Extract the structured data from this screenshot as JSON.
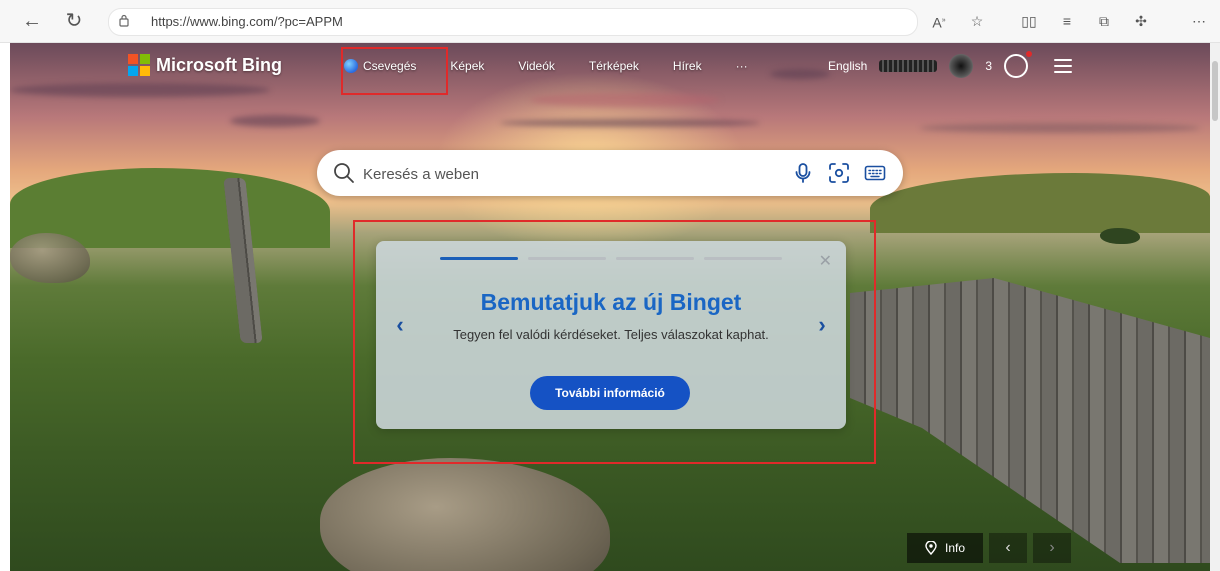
{
  "browser": {
    "url": "https://www.bing.com/?pc=APPM"
  },
  "header": {
    "brand": "Microsoft Bing",
    "nav": [
      {
        "label": "Csevegés"
      },
      {
        "label": "Képek"
      },
      {
        "label": "Videók"
      },
      {
        "label": "Térképek"
      },
      {
        "label": "Hírek"
      },
      {
        "label": "···"
      }
    ],
    "language": "English",
    "rewards_count": "3"
  },
  "search": {
    "placeholder": "Keresés a weben"
  },
  "promo": {
    "title": "Bemutatjuk az új Binget",
    "body": "Tegyen fel valódi kérdéseket. Teljes válaszokat kaphat.",
    "button_label": "További információ",
    "slides_total": 4,
    "active_slide": 1
  },
  "footer": {
    "info_label": "Info"
  },
  "colors": {
    "accent": "#1552c4",
    "highlight": "#e02a2a"
  }
}
